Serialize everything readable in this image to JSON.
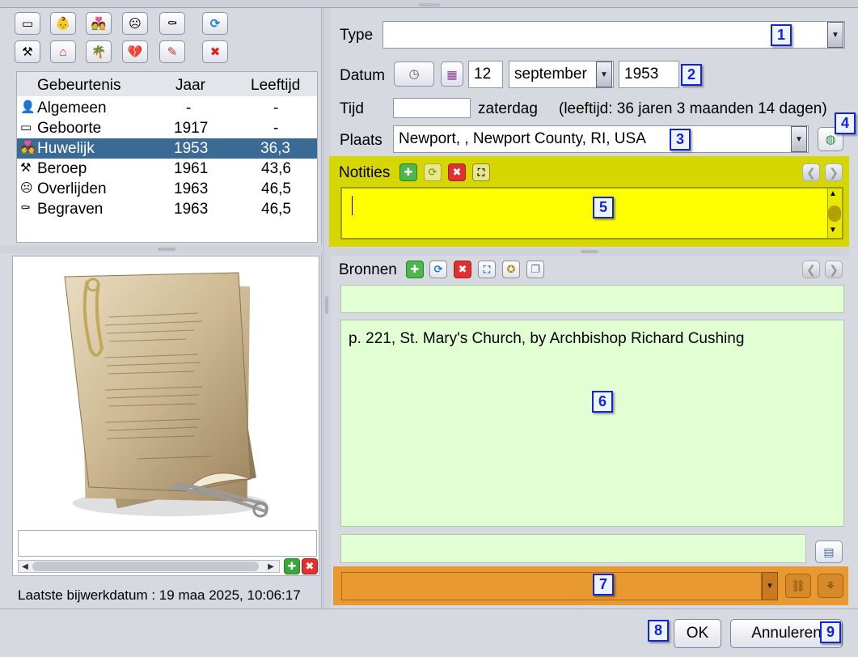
{
  "toolbar": {
    "row1": [
      {
        "name": "add-general-button",
        "glyph": "▭"
      },
      {
        "name": "add-birth-button",
        "glyph": "👶"
      },
      {
        "name": "add-marriage-button",
        "glyph": "💑"
      },
      {
        "name": "add-death-button",
        "glyph": "☹"
      },
      {
        "name": "add-burial-button",
        "glyph": "⚰"
      },
      {
        "name": "refresh-button",
        "glyph": "⟳"
      }
    ],
    "row2": [
      {
        "name": "add-occupation-button",
        "glyph": "⚒"
      },
      {
        "name": "add-residence-button",
        "glyph": "⌂"
      },
      {
        "name": "add-emigration-button",
        "glyph": "🌴"
      },
      {
        "name": "add-divorce-button",
        "glyph": "💔"
      },
      {
        "name": "add-event-button",
        "glyph": "✎"
      },
      {
        "name": "delete-event-button",
        "glyph": "✖"
      }
    ]
  },
  "events": {
    "headers": {
      "event": "Gebeurtenis",
      "year": "Jaar",
      "age": "Leeftijd"
    },
    "rows": [
      {
        "icon": "👤",
        "event": "Algemeen",
        "year": "-",
        "age": "-"
      },
      {
        "icon": "▭",
        "event": "Geboorte",
        "year": "1917",
        "age": "-"
      },
      {
        "icon": "💑",
        "event": "Huwelijk",
        "year": "1953",
        "age": "36,3"
      },
      {
        "icon": "⚒",
        "event": "Beroep",
        "year": "1961",
        "age": "43,6"
      },
      {
        "icon": "☹",
        "event": "Overlijden",
        "year": "1963",
        "age": "46,5"
      },
      {
        "icon": "⚰",
        "event": "Begraven",
        "year": "1963",
        "age": "46,5"
      }
    ]
  },
  "media": {
    "caption_value": "",
    "add_glyph": "✚",
    "delete_glyph": "✖"
  },
  "last_update": "Laatste bijwerkdatum : 19 maa 2025, 10:06:17",
  "form": {
    "type_label": "Type",
    "type_value": "",
    "date_label": "Datum",
    "day": "12",
    "month": "september",
    "year": "1953",
    "time_label": "Tijd",
    "time_value": "",
    "weekday": "zaterdag",
    "age_text": "(leeftijd: 36 jaren 3 maanden 14 dagen)",
    "place_label": "Plaats",
    "place_value": "Newport, , Newport County, RI, USA"
  },
  "notes": {
    "label": "Notities",
    "text": "",
    "bg_color": "#d6d600"
  },
  "sources": {
    "label": "Bronnen",
    "title_value": "",
    "detail_text": "p. 221, St. Mary's Church, by Archbishop Richard Cushing",
    "footer_value": "",
    "bg_color": "#e2ffd4"
  },
  "citation": {
    "value": "",
    "bg_color": "#e8992f"
  },
  "badges": [
    "1",
    "2",
    "3",
    "4",
    "5",
    "6",
    "7",
    "8",
    "9"
  ],
  "buttons": {
    "ok": "OK",
    "cancel": "Annuleren"
  }
}
